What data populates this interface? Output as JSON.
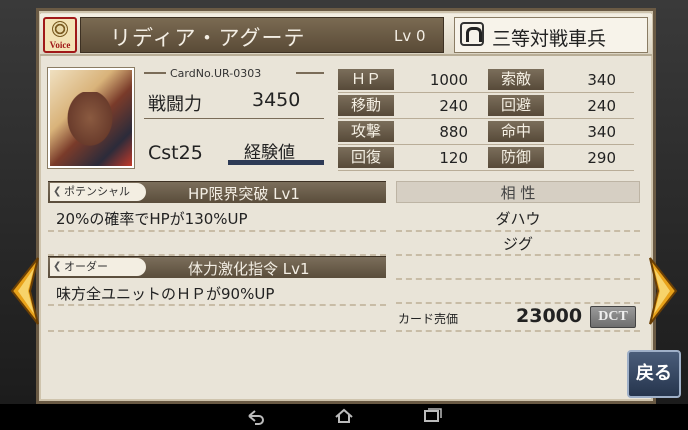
{
  "header": {
    "voice_label": "Voice",
    "character_name": "リディア・アグーテ",
    "level": "Lv 0",
    "class_name": "三等対戦車兵"
  },
  "profile": {
    "card_no": "CardNo.UR-0303",
    "power_label": "戦闘力",
    "power_value": "3450",
    "cost": "Cst25",
    "exp_label": "経験値"
  },
  "stats_left": [
    {
      "label": "ＨＰ",
      "value": "1000"
    },
    {
      "label": "移動",
      "value": "240"
    },
    {
      "label": "攻撃",
      "value": "880"
    },
    {
      "label": "回復",
      "value": "120"
    }
  ],
  "stats_right": [
    {
      "label": "索敵",
      "value": "340"
    },
    {
      "label": "回避",
      "value": "240"
    },
    {
      "label": "命中",
      "value": "340"
    },
    {
      "label": "防御",
      "value": "290"
    }
  ],
  "potential": {
    "tag": "ポテンシャル",
    "name": "HP限界突破 Lv1",
    "description": "20%の確率でHPが130%UP"
  },
  "order": {
    "tag": "オーダー",
    "name": "体力激化指令 Lv1",
    "description": "味方全ユニットのＨＰが90%UP"
  },
  "affinity": {
    "title": "相 性",
    "items": [
      "ダハウ",
      "ジグ"
    ]
  },
  "sell": {
    "label": "カード売価",
    "value": "23000",
    "currency": "DCT"
  },
  "back_label": "戻る",
  "icons": {
    "voice": "speaker-icon",
    "class": "anti-tank-class-icon",
    "prev": "arrow-left-icon",
    "next": "arrow-right-icon",
    "nav_back": "back-icon",
    "nav_home": "home-icon",
    "nav_recents": "recents-icon"
  }
}
